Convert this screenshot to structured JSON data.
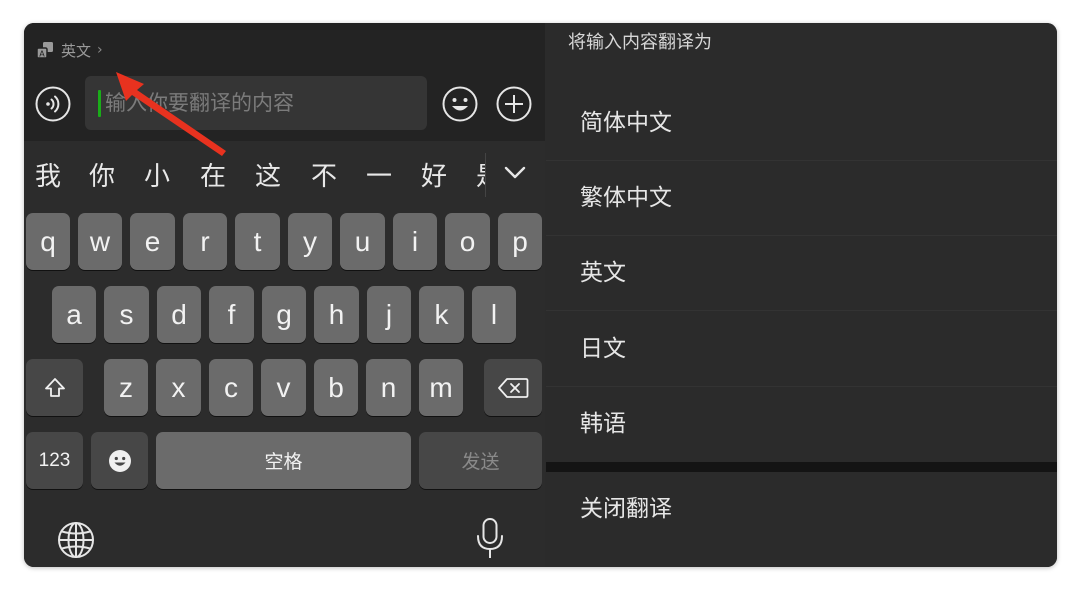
{
  "input_bar": {
    "lang_label": "英文",
    "placeholder": "输入你要翻译的内容"
  },
  "candidates": [
    "我",
    "你",
    "小",
    "在",
    "这",
    "不",
    "一",
    "好"
  ],
  "candidate_partial": "是",
  "keyboard": {
    "row1": [
      "q",
      "w",
      "e",
      "r",
      "t",
      "y",
      "u",
      "i",
      "o",
      "p"
    ],
    "row2": [
      "a",
      "s",
      "d",
      "f",
      "g",
      "h",
      "j",
      "k",
      "l"
    ],
    "row3": [
      "z",
      "x",
      "c",
      "v",
      "b",
      "n",
      "m"
    ],
    "numbers_label": "123",
    "space_label": "空格",
    "send_label": "发送"
  },
  "translate_panel": {
    "title": "将输入内容翻译为",
    "options": [
      "简体中文",
      "繁体中文",
      "英文",
      "日文",
      "韩语"
    ],
    "close_label": "关闭翻译"
  },
  "colors": {
    "caret": "#1aad19",
    "annotation_arrow": "#e8321f"
  },
  "icons": {
    "translate": "translate-icon",
    "voice": "voice-icon",
    "emoji": "emoji-icon",
    "add": "plus-circle-icon",
    "expand": "chevron-down-icon",
    "shift": "shift-icon",
    "backspace": "backspace-icon",
    "globe": "globe-icon",
    "mic": "microphone-icon"
  }
}
